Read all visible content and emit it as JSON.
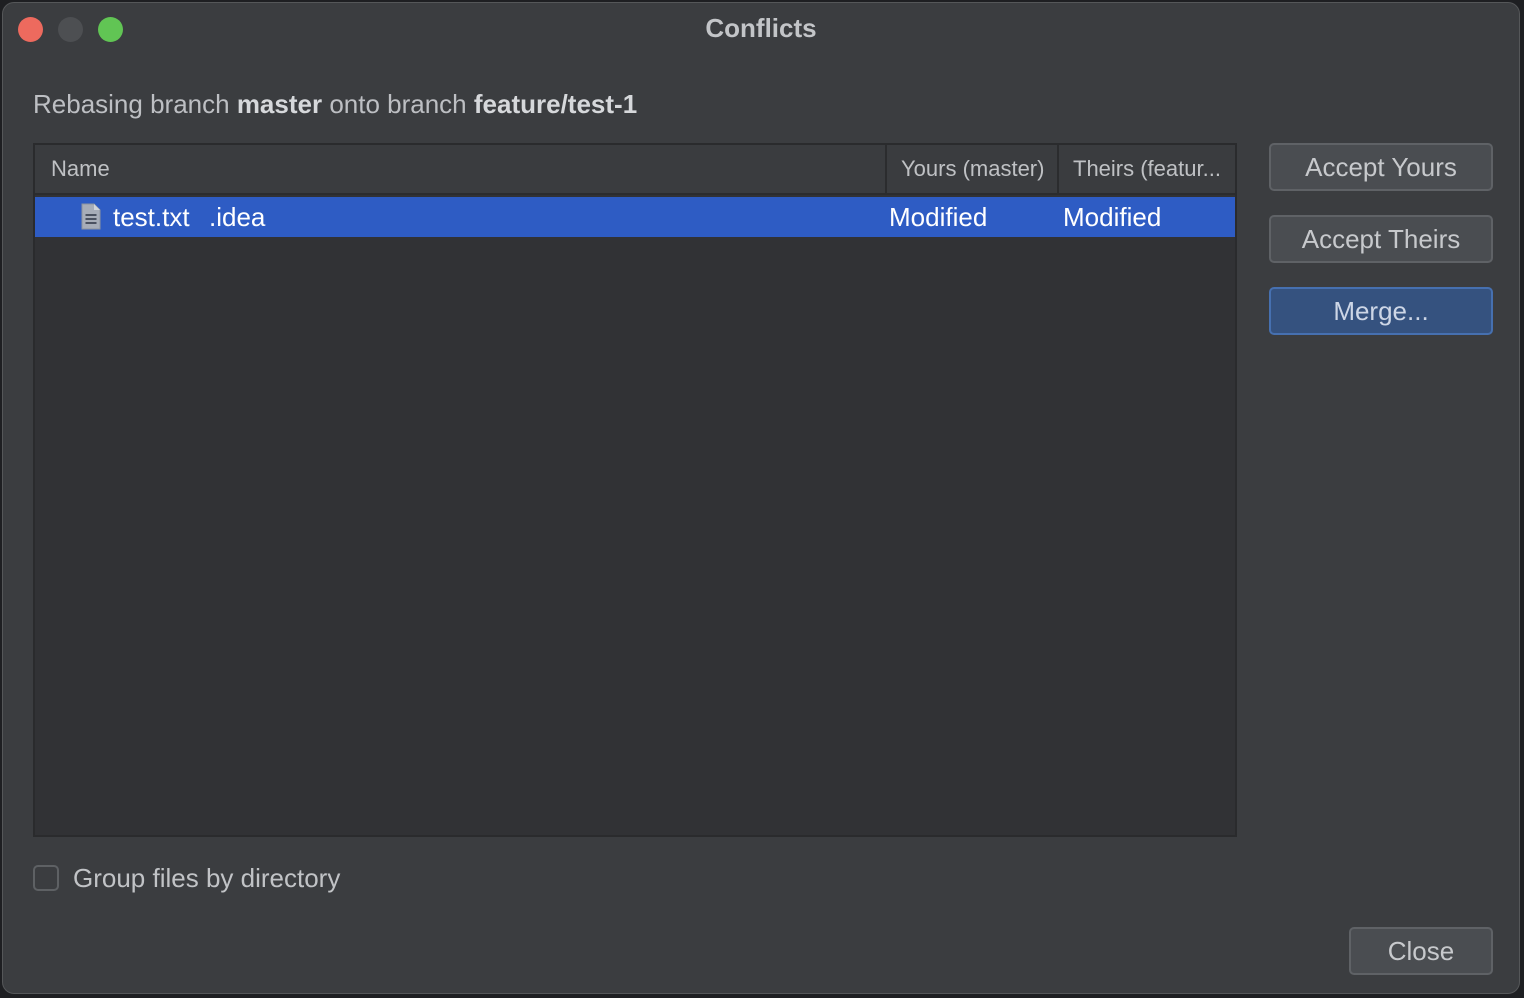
{
  "window": {
    "title": "Conflicts"
  },
  "subtitle": {
    "prefix": "Rebasing branch ",
    "source_branch": "master",
    "middle": " onto branch ",
    "target_branch": "feature/test-1"
  },
  "table": {
    "columns": {
      "name": "Name",
      "yours": "Yours (master)",
      "theirs": "Theirs (featur..."
    },
    "rows": [
      {
        "icon": "text-file-icon",
        "filename": "test.txt",
        "directory": ".idea",
        "yours": "Modified",
        "theirs": "Modified",
        "selected": true
      }
    ]
  },
  "actions": {
    "accept_yours": "Accept Yours",
    "accept_theirs": "Accept Theirs",
    "merge": "Merge..."
  },
  "options": {
    "group_by_directory_label": "Group files by directory",
    "group_by_directory_checked": false
  },
  "footer": {
    "close_label": "Close"
  },
  "colors": {
    "selection": "#2e5cc4",
    "merge_button": "#35527f",
    "traffic_close": "#ed6a5e",
    "traffic_max": "#61c554"
  }
}
